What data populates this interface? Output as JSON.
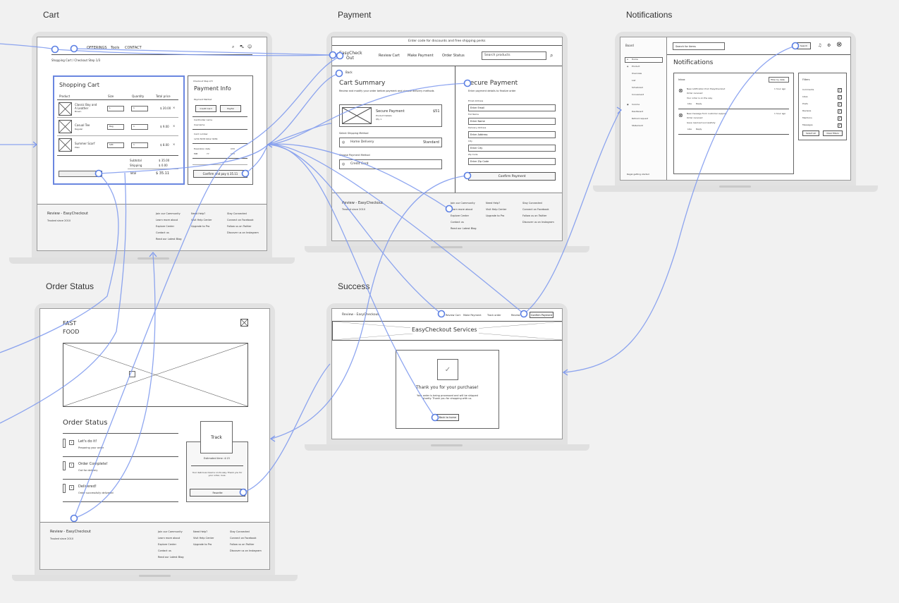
{
  "frames": {
    "cart": "Cart",
    "payment": "Payment",
    "notifications": "Notifications",
    "order_status": "Order Status",
    "success": "Success"
  },
  "colors": {
    "wire": "#7b97ee",
    "selection": "#6a86e0",
    "canvas": "#f1f1f1"
  },
  "cart": {
    "nav": [
      "OFFERINGS",
      "Tools",
      "CONTACT"
    ],
    "icons": [
      "search-icon",
      "cart-icon",
      "user-icon"
    ],
    "breadcrumb_home": "Shopping Cart",
    "breadcrumb_current": "Checkout Step 1/3",
    "title": "Shopping Cart",
    "columns": [
      "Product",
      "Size",
      "Quantity",
      "Total price"
    ],
    "items": [
      {
        "name": "Classic Boy and A Leather",
        "sub": "Brown",
        "size": "L",
        "qty": "1",
        "price": "$ 20.00",
        "remove": "×"
      },
      {
        "name": "Casual Tee",
        "sub": "Regular",
        "size": "Reg",
        "qty": "1",
        "price": "$ 9.00",
        "remove": "×"
      },
      {
        "name": "Summer Scarf",
        "sub": "Plain",
        "size": "S/M",
        "qty": "1",
        "price": "$ 8.00",
        "remove": "×"
      }
    ],
    "subtotal_label": "Subtotal",
    "subtotal_value": "$ 35.00",
    "shipping_label": "Shipping",
    "shipping_value": "$ 0.00",
    "total_label": "Total",
    "total_value": "$ 35.11",
    "pay": {
      "step": "Checkout Step 2/3",
      "title": "Payment Info",
      "method_label": "Payment Method",
      "methods": [
        "Credit Card",
        "PayPal"
      ],
      "field_labels": [
        "Cardholder name",
        "Card number",
        "Expiration date",
        "CVV"
      ],
      "field_values": [
        "Username",
        "1234 5678 9012 3456",
        "MM",
        "YY",
        "123"
      ],
      "confirm": "Confirm and pay $ 35.11"
    },
    "footer": {
      "brand": "Review - EasyCheckout",
      "tagline": "Trusted since 2010",
      "cols": [
        {
          "title": "Join our Community",
          "links": [
            "Learn more about",
            "Explore Center",
            "Contact us",
            "Read our Latest Blog"
          ]
        },
        {
          "title": "Need Help?",
          "links": [
            "Visit Help Center",
            "Upgrade to Pro"
          ]
        },
        {
          "title": "Stay Connected",
          "links": [
            "Connect on Facebook",
            "Follow us on Twitter",
            "Discover us on Instagram"
          ]
        }
      ]
    }
  },
  "payment": {
    "banner": "Enter code for discounts and free shipping perks",
    "logo_line1": "EasyCheck",
    "logo_line2": "Out",
    "nav": [
      "Review Cart",
      "Make Payment",
      "Order Status"
    ],
    "search_placeholder": "Search products",
    "back": "Back",
    "summary_title": "Cart Summary",
    "summary_sub": "Review and modify your order before payment and choose delivery methods",
    "item_name": "Secure Payment",
    "item_price": "$51",
    "item_sub1": "Product Details",
    "item_sub2": "Qty 1",
    "shipping_method_label": "Select Shipping Method",
    "shipping_option": "Home Delivery",
    "shipping_value": "Standard",
    "payment_method_label": "Choose Payment Method",
    "payment_option": "Credit Card",
    "secure_title": "Secure Payment",
    "secure_sub": "Enter payment details to finalize order",
    "fields": [
      {
        "label": "Email Address",
        "value": "Enter Email"
      },
      {
        "label": "Full Name",
        "value": "Enter Name"
      },
      {
        "label": "Delivery Address",
        "value": "Enter Address"
      },
      {
        "label": "City",
        "value": "Enter City"
      },
      {
        "label": "Zip Code",
        "value": "Enter Zip Code"
      }
    ],
    "confirm": "Confirm Payment"
  },
  "notifications": {
    "sidebar_brand": "Board",
    "sidebar_items": [
      "Home",
      "Product",
      "Overview",
      "List",
      "Scheduled",
      "Convenient",
      "Income",
      "Dashboard",
      "Refund request",
      "Statement"
    ],
    "sidebar_footer": "Regal getting started",
    "search_placeholder": "Search for items",
    "search_button": "Search",
    "title": "Notifications",
    "inbox_label": "Inbox",
    "filter": "Filter by date",
    "items": [
      {
        "title": "New notification from EasyCheckout",
        "sub1": "Order received",
        "sub2": "Your order is on the way",
        "time": "1 hour ago",
        "actions": [
          "Like",
          "Reply"
        ]
      },
      {
        "title": "New message from customer support",
        "sub1": "Order received",
        "sub2": "Issue resolved successfully",
        "time": "1 hour ago",
        "actions": [
          "Like",
          "Reply"
        ]
      }
    ],
    "filters_title": "Filters",
    "filters": [
      "Comments",
      "Likes",
      "Posts",
      "Reviews",
      "Mentions",
      "Messages"
    ],
    "filter_buttons": [
      "Select all",
      "Clear filters"
    ]
  },
  "order_status": {
    "brand_line1": "FAST",
    "brand_line2": "FOOD",
    "title": "Order Status",
    "steps": [
      {
        "num": "1",
        "title": "Let's do it!",
        "sub": "Preparing your order"
      },
      {
        "num": "2",
        "title": "Order Complete!",
        "sub": "Out for delivery"
      },
      {
        "num": "3",
        "title": "Delivered!",
        "sub": "Order successfully delivered"
      }
    ],
    "track": "Track",
    "eta_title": "Estimated time: 4:15",
    "eta_sub": "Your delicious meal is on its way. Thank you for your order, love.",
    "favorite": "Favorite",
    "footer_brand": "Review - EasyCheckout",
    "footer_tagline": "Trusted since 2010"
  },
  "success": {
    "brand": "Review - EasyCheckout",
    "nav": [
      "Review Cart",
      "Make Payment",
      "Track order",
      "Review"
    ],
    "nav_button": "Confirm Payment",
    "hero": "EasyCheckout Services",
    "thanks": "Thank you for your purchase!",
    "message": "Your order is being processed and will be shipped shortly. Thank you for shopping with us.",
    "back": "Back to home"
  }
}
